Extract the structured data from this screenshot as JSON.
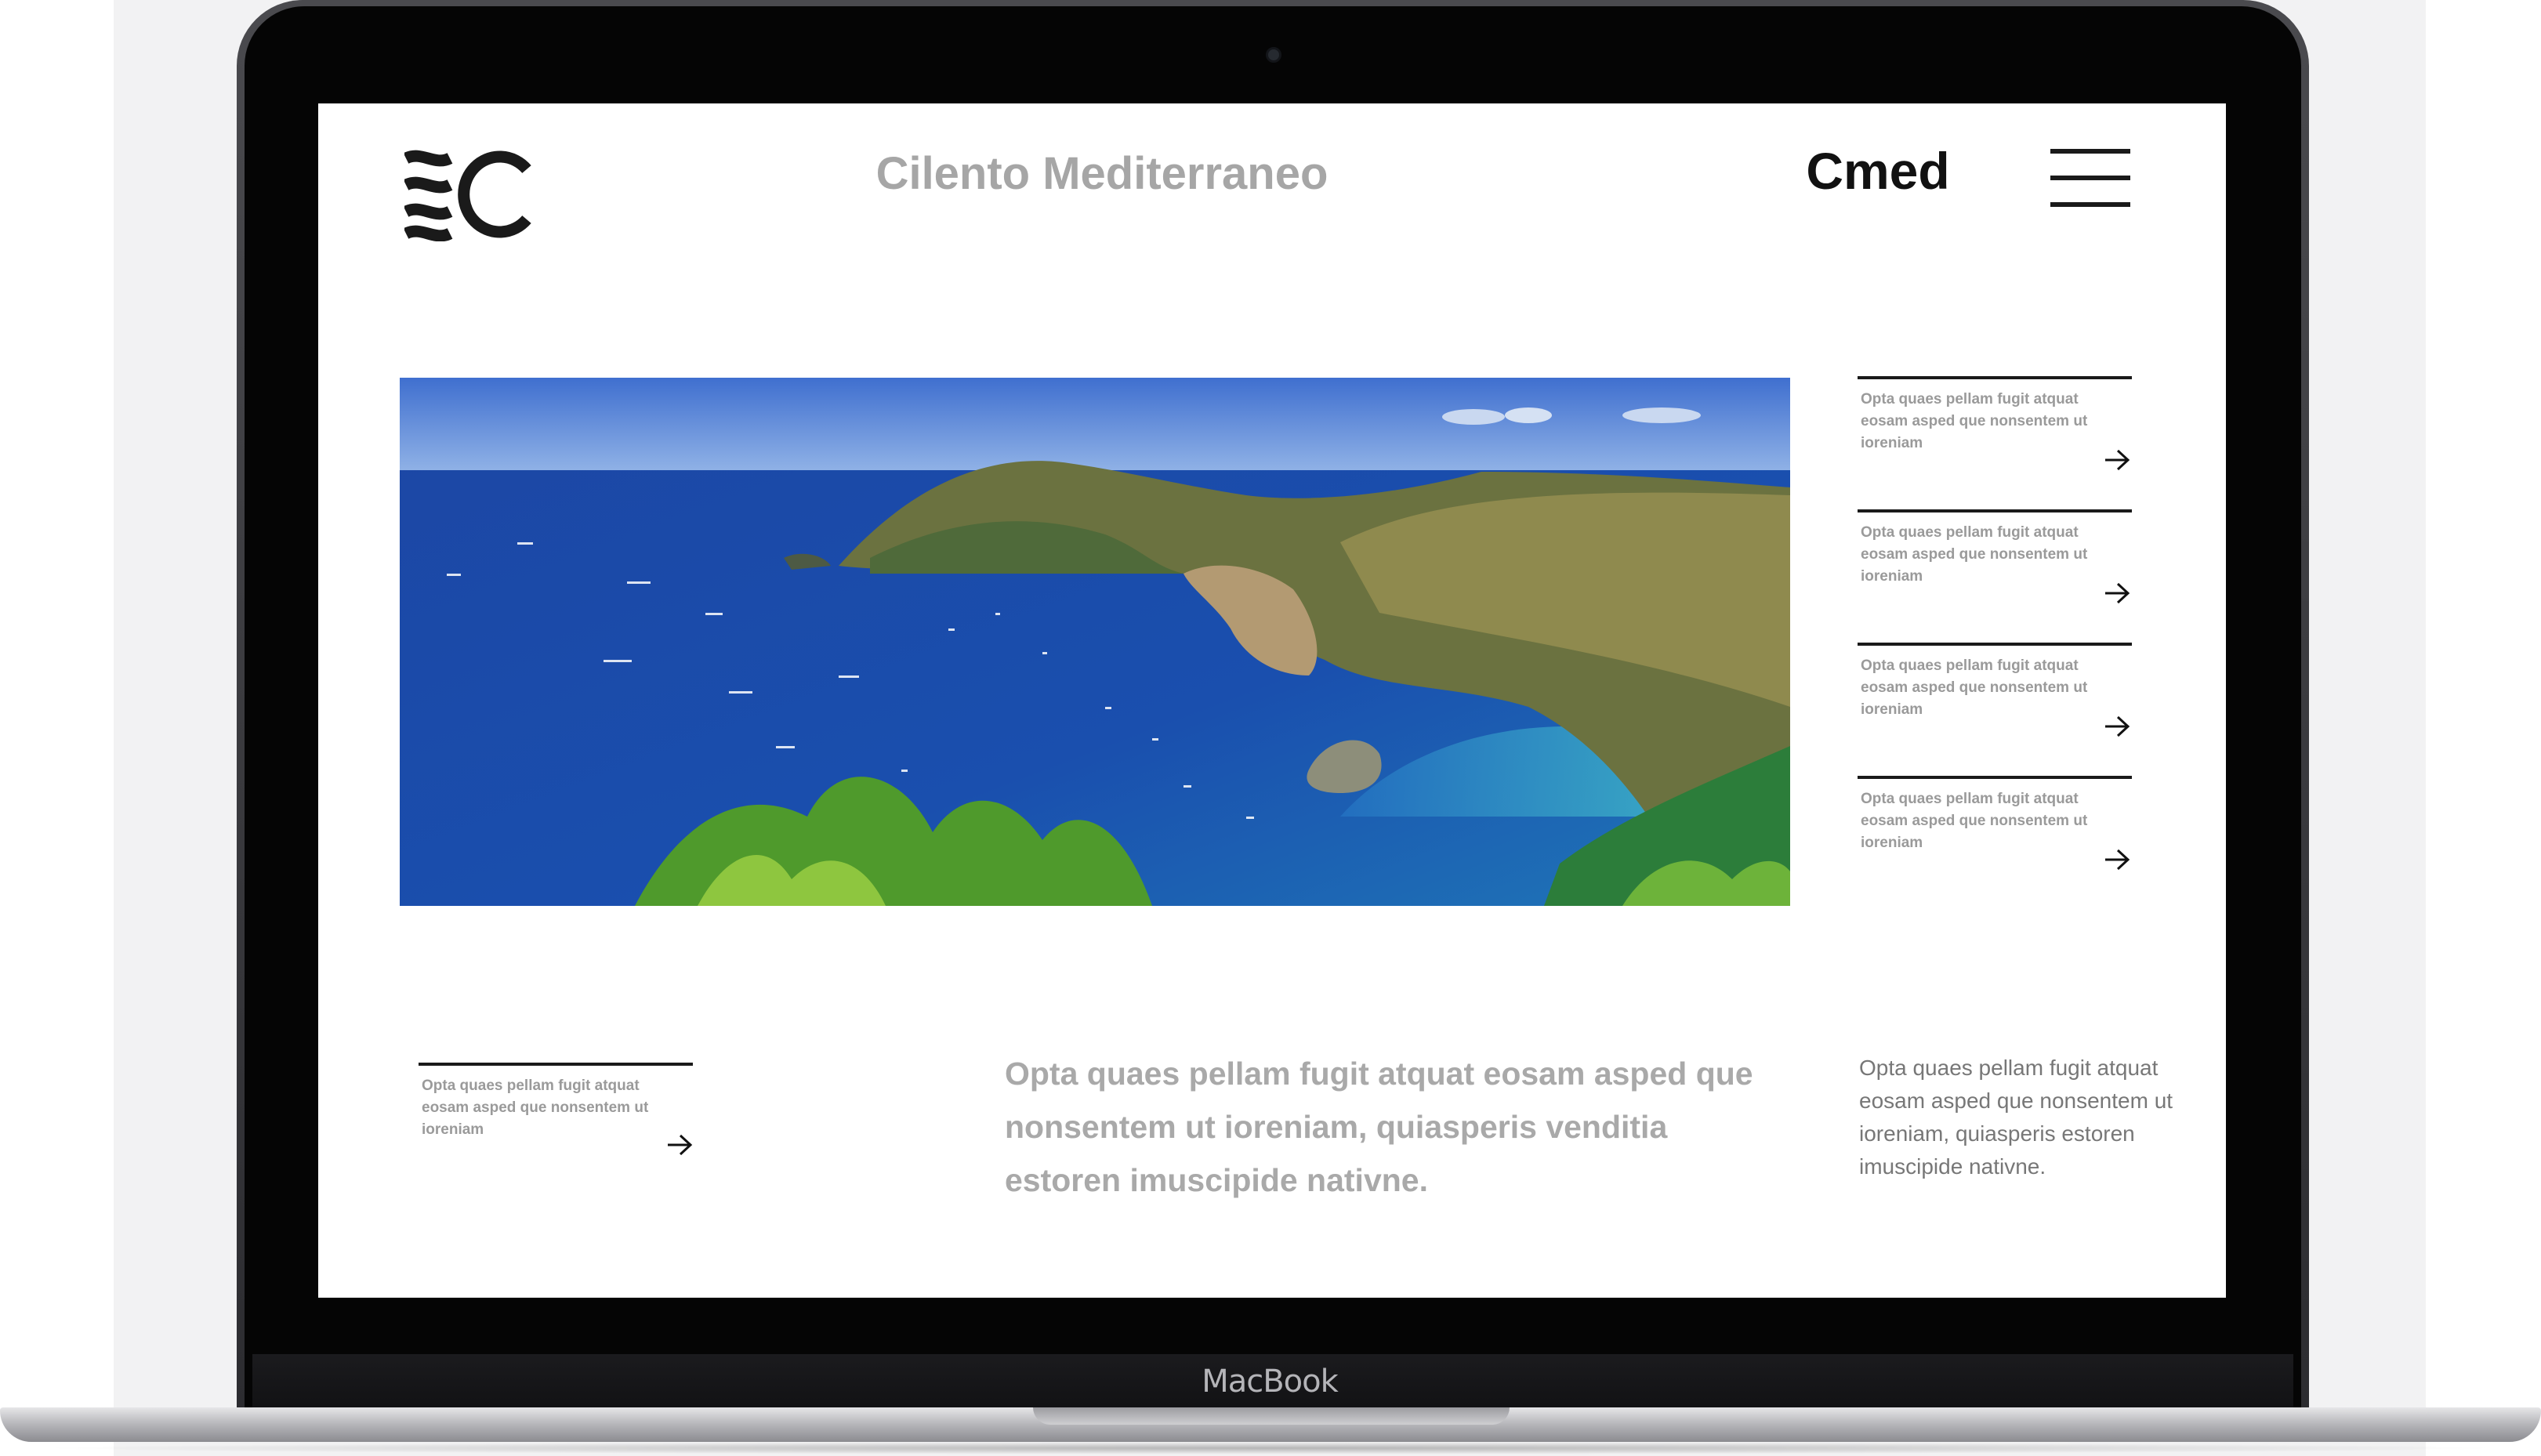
{
  "device": {
    "brand_label": "MacBook"
  },
  "header": {
    "title": "Cilento Mediterraneo",
    "brand_short": "Cmed"
  },
  "hero": {
    "alt": "Coastal bay with blue sea, cliffs and green vegetation"
  },
  "sidebar": {
    "items": [
      {
        "text": "Opta quaes pellam fugit atquat eosam asped que nonsentem ut ioreniam"
      },
      {
        "text": "Opta quaes pellam fugit atquat eosam asped que nonsentem ut ioreniam"
      },
      {
        "text": "Opta quaes pellam fugit atquat eosam asped que nonsentem ut ioreniam"
      },
      {
        "text": "Opta quaes pellam fugit atquat eosam asped que nonsentem ut ioreniam"
      }
    ]
  },
  "bottom": {
    "card_text": "Opta quaes pellam fugit atquat eosam asped que nonsentem ut ioreniam",
    "lead_text": "Opta quaes pellam fugit atquat eosam asped que nonsentem ut ioreniam, quiasperis venditia estoren imuscipide nativne.",
    "body_text": "Opta quaes pellam fugit atquat eosam asped que nonsentem ut ioreniam, quiasperis estoren imuscipide nativne."
  },
  "icons": {
    "logo": "wave-c-logo-icon",
    "menu": "hamburger-menu-icon",
    "arrow": "arrow-right-icon"
  },
  "colors": {
    "title_gray": "#a6a6a6",
    "text_gray": "#9a9a9a",
    "dark": "#111111",
    "sea_blue": "#1f4aa8"
  }
}
